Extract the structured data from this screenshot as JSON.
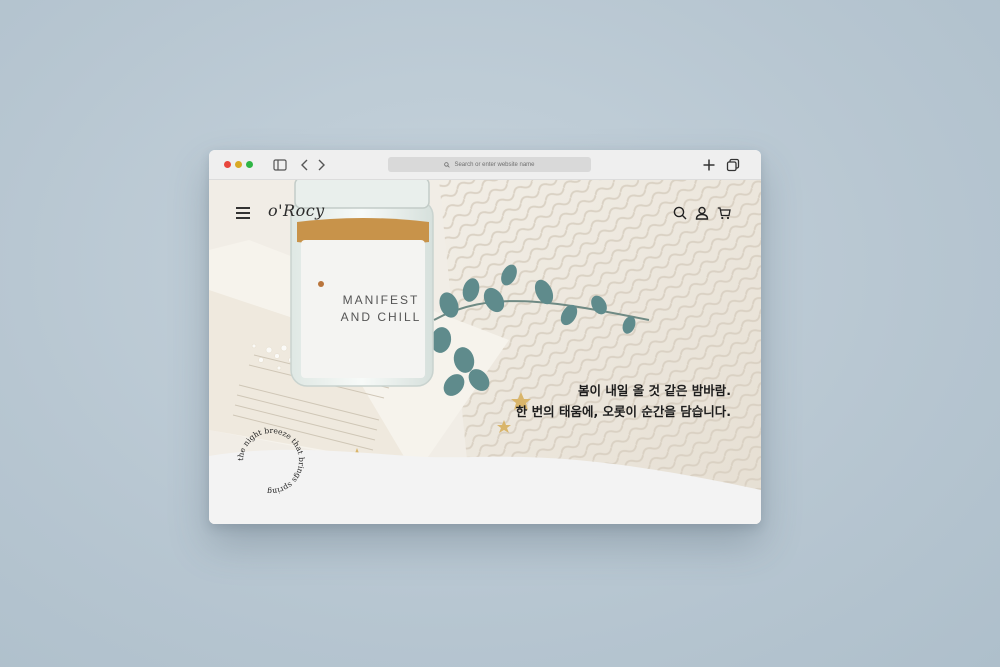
{
  "browser": {
    "address_placeholder": "Search or enter website name",
    "traffic_light_colors": [
      "#e8463d",
      "#d9a925",
      "#2fb545"
    ]
  },
  "site": {
    "logo": "o'Rocy",
    "nav_icons": [
      "menu-icon",
      "search-icon",
      "user-icon",
      "cart-icon"
    ]
  },
  "hero": {
    "jar_label_line1": "MANIFEST",
    "jar_label_line2": "AND CHILL",
    "tagline_line1": "봄이 내일 올 것 같은 밤바람.",
    "tagline_line2": "한 번의 태움에, 오롯이 순간을 담습니다.",
    "circular_text": "the night breeze that brings spring"
  }
}
